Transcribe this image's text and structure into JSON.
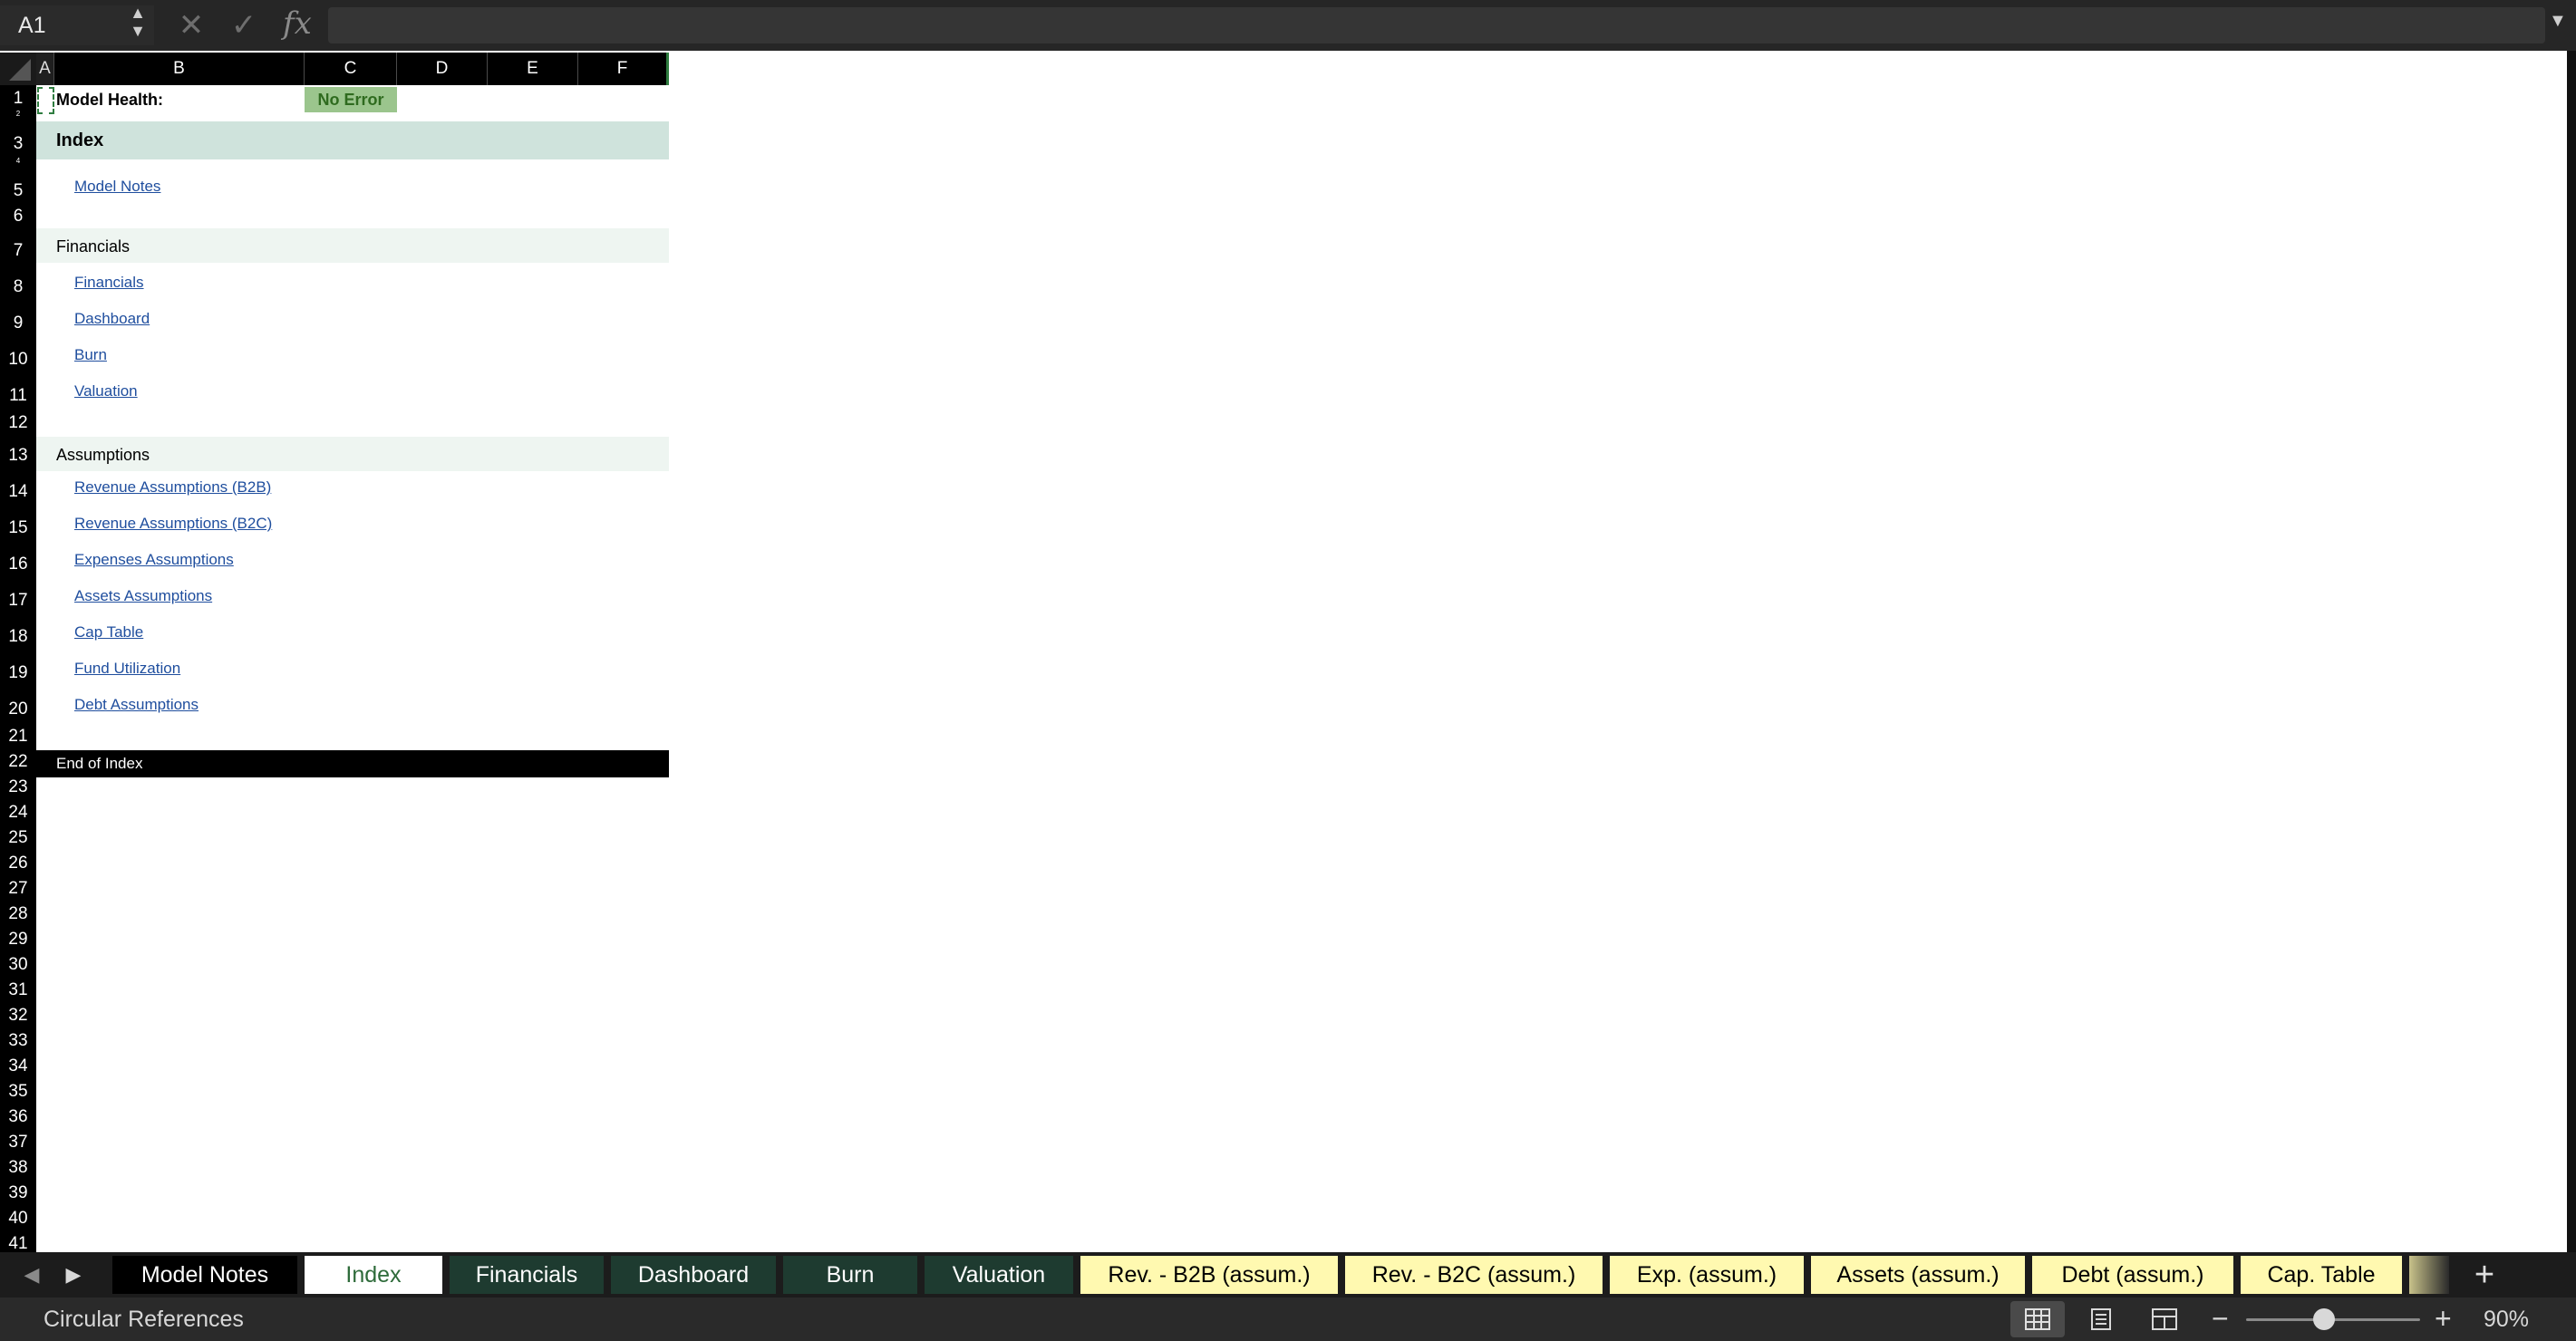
{
  "formula_bar": {
    "cell_ref": "A1",
    "formula": "",
    "fx_label": "fx"
  },
  "columns": [
    "A",
    "B",
    "C",
    "D",
    "E",
    "F"
  ],
  "rows": [
    1,
    2,
    3,
    4,
    5,
    6,
    7,
    8,
    9,
    10,
    11,
    12,
    13,
    14,
    15,
    16,
    17,
    18,
    19,
    20,
    21,
    22,
    23,
    24,
    25,
    26,
    27,
    28,
    29,
    30,
    31,
    32,
    33,
    34,
    35,
    36,
    37,
    38,
    39,
    40,
    41
  ],
  "sheet": {
    "health_label": "Model Health:",
    "health_status": "No Error",
    "index_title": "Index",
    "model_notes_link": "Model Notes",
    "financials_section": "Financials",
    "financials_links": [
      "Financials",
      "Dashboard",
      "Burn",
      "Valuation"
    ],
    "assumptions_section": "Assumptions",
    "assumptions_links": [
      "Revenue Assumptions (B2B)",
      "Revenue Assumptions (B2C)",
      "Expenses Assumptions",
      "Assets Assumptions",
      "Cap Table",
      "Fund Utilization",
      "Debt Assumptions"
    ],
    "end_label": "End of Index"
  },
  "tabs": [
    {
      "label": "Model Notes",
      "style": "dark"
    },
    {
      "label": "Index",
      "style": "active"
    },
    {
      "label": "Financials",
      "style": "green"
    },
    {
      "label": "Dashboard",
      "style": "green"
    },
    {
      "label": "Burn",
      "style": "green"
    },
    {
      "label": "Valuation",
      "style": "green"
    },
    {
      "label": "Rev. - B2B (assum.)",
      "style": "yellow"
    },
    {
      "label": "Rev. - B2C (assum.)",
      "style": "yellow"
    },
    {
      "label": "Exp. (assum.)",
      "style": "yellow"
    },
    {
      "label": "Assets (assum.)",
      "style": "yellow"
    },
    {
      "label": "Debt (assum.)",
      "style": "yellow"
    },
    {
      "label": "Cap. Table",
      "style": "yellow"
    }
  ],
  "status": {
    "message": "Circular References",
    "zoom": "90%",
    "zoom_percent": 90
  },
  "colors": {
    "index_band": "#cfe3dc",
    "section_band": "#eef5f1",
    "badge": "#9bc58d",
    "tab_green": "#1e3b30",
    "tab_yellow": "#fff9b0",
    "link": "#1f4e9e"
  }
}
